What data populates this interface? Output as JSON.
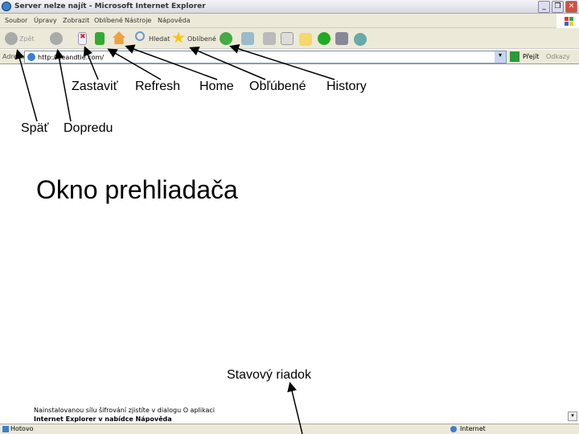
{
  "window": {
    "title": "Server nelze najít - Microsoft Internet Explorer",
    "min": "_",
    "max": "❐",
    "close": "✕"
  },
  "menu": [
    "Soubor",
    "Úpravy",
    "Zobrazit",
    "Oblíbené",
    "Nástroje",
    "Nápověda"
  ],
  "toolbar": {
    "back": "Zpět",
    "search": "Hledat",
    "favorites": "Oblíbené"
  },
  "address": {
    "label": "Adresa",
    "value": "http://eeandtie.com/",
    "go": "Přejít",
    "links": "Odkazy"
  },
  "page": {
    "line1": "Nainstalovanou sílu šifrování zjistíte v dialogu O aplikaci",
    "line2": "Internet Explorer v nabídce Nápověda"
  },
  "status": {
    "left": "Hotovo",
    "zone": "Internet"
  },
  "annotations": {
    "stop": "Zastaviť",
    "refresh": "Refresh",
    "home": "Home",
    "favorites": "Obľúbené",
    "history": "History",
    "back": "Späť",
    "forward": "Dopredu",
    "window": "Okno prehliadača",
    "statusbar": "Stavový riadok"
  }
}
